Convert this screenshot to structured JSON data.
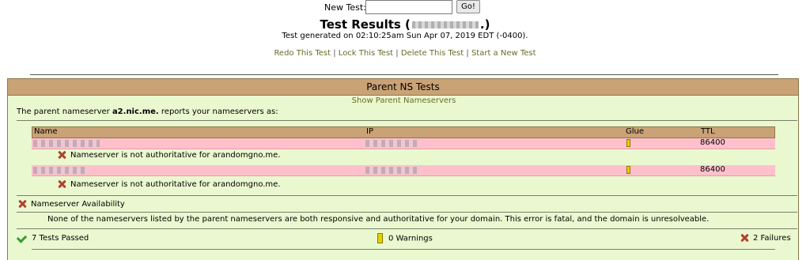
{
  "new_test": {
    "label": "New Test:",
    "value": "",
    "go_label": "Go!"
  },
  "title": {
    "prefix": "Test Results (",
    "suffix": ".)"
  },
  "generated": "Test generated on 02:10:25am Sun Apr 07, 2019 EDT (-0400).",
  "links": {
    "redo": "Redo This Test",
    "lock": "Lock This Test",
    "delete": "Delete This Test",
    "start": "Start a New Test",
    "separator": "|"
  },
  "panel": {
    "title": "Parent NS Tests",
    "show_parent": "Show Parent Nameservers",
    "reports_prefix": "The parent nameserver ",
    "reports_server": "a2.nic.me.",
    "reports_suffix": " reports your nameservers as:"
  },
  "table": {
    "headers": {
      "name": "Name",
      "ip": "IP",
      "glue": "Glue",
      "ttl": "TTL"
    },
    "rows": [
      {
        "ttl": "86400",
        "error": "Nameserver is not authoritative for arandomgno.me."
      },
      {
        "ttl": "86400",
        "error": "Nameserver is not authoritative for arandomgno.me."
      }
    ]
  },
  "availability": {
    "label": "Nameserver Availability",
    "message": "None of the nameservers listed by the parent nameservers are both responsive and authoritative for your domain. This error is fatal, and the domain is unresolveable."
  },
  "summary": {
    "passed": "7 Tests Passed",
    "warnings": "0 Warnings",
    "failures": "2 Failures"
  },
  "colors": {
    "panel_bg": "#eaf8d0",
    "header_bg": "#c9a276",
    "error_row": "#ffc0cb",
    "link": "#6b6b2a"
  }
}
